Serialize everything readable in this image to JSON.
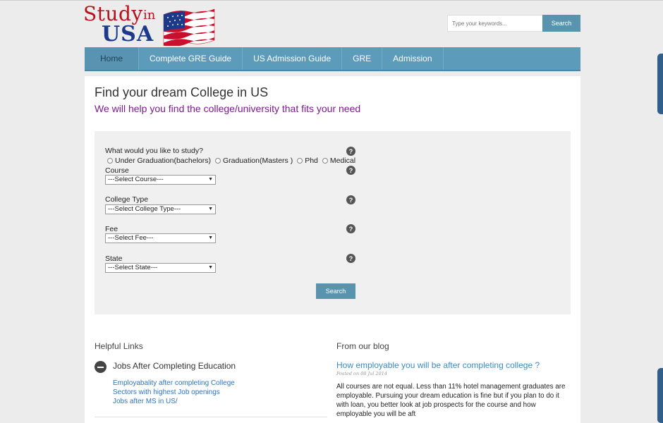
{
  "header": {
    "logo": {
      "word1": "Study",
      "word2": "in",
      "word3": "USA"
    },
    "search": {
      "placeholder": "Type your keywords...",
      "button_label": "Search"
    }
  },
  "nav": {
    "items": [
      {
        "label": "Home",
        "active": true
      },
      {
        "label": "Complete GRE Guide"
      },
      {
        "label": "US Admission Guide"
      },
      {
        "label": "GRE"
      },
      {
        "label": "Admission"
      }
    ]
  },
  "main": {
    "title": "Find your dream College in US",
    "subtitle": "We will help you find the college/university that fits your need",
    "form": {
      "study_label": "What would you like to study?",
      "study_options": [
        "Under Graduation(bachelors)",
        "Graduation(Masters )",
        "Phd",
        "Medical"
      ],
      "course_label": "Course",
      "course_selected": "---Select Course---",
      "college_type_label": "College Type",
      "college_type_selected": "---Select College Type---",
      "fee_label": "Fee",
      "fee_selected": "---Select Fee---",
      "state_label": "State",
      "state_selected": "---Select State---",
      "help_icon_glyph": "?",
      "search_label": "Search"
    },
    "helpful_links": {
      "title": "Helpful Links",
      "section_title": "Jobs After Completing Education",
      "links": [
        "Employabality after completing College",
        "Sectors with highest Job openings",
        "Jobs after MS in US/"
      ]
    },
    "blog": {
      "title": "From our blog",
      "post_title": "How employable you will be after completing college ?",
      "post_date": "Posted on 08 Jul 2014",
      "post_excerpt": "All courses are not equal. Less than 11% hotel management graduates are employable. Pursuing your dream education is fine but if you plan to do it with loan, you better look at job prospects for the course and how employable you will be aft"
    }
  },
  "colors": {
    "nav": "#5d9bbb",
    "button": "#5a93ad",
    "subtitle": "#7a1b8c",
    "link": "#2a74c9",
    "logo_red": "#b5121b",
    "logo_blue": "#1d3a8a"
  }
}
